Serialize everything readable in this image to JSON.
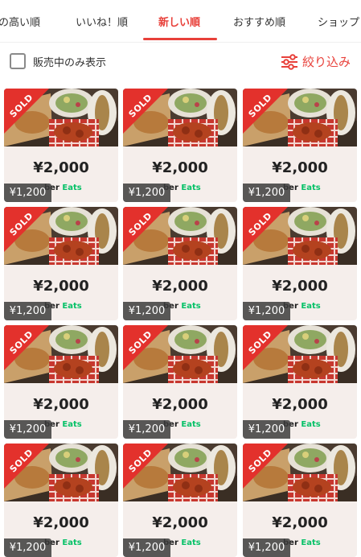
{
  "tabs": [
    {
      "label": "の高い順",
      "active": false
    },
    {
      "label": "いいね！順",
      "active": false
    },
    {
      "label": "新しい順",
      "active": true
    },
    {
      "label": "おすすめ順",
      "active": false
    },
    {
      "label": "ショップ",
      "active": false
    }
  ],
  "filter": {
    "checkbox_label": "販売中のみ表示",
    "checkbox_checked": false,
    "filter_button_label": "絞り込み",
    "filter_icon": "sliders-icon"
  },
  "colors": {
    "accent": "#e8403a",
    "sold": "#e3312c",
    "eats_green": "#06c167"
  },
  "items": [
    {
      "sold_label": "SOLD",
      "amount": "¥2,000",
      "brand_prefix": "ber",
      "brand_suffix": "Eats",
      "price": "¥1,200"
    },
    {
      "sold_label": "SOLD",
      "amount": "¥2,000",
      "brand_prefix": "ber",
      "brand_suffix": "Eats",
      "price": "¥1,200"
    },
    {
      "sold_label": "SOLD",
      "amount": "¥2,000",
      "brand_prefix": "ber",
      "brand_suffix": "Eats",
      "price": "¥1,200"
    },
    {
      "sold_label": "SOLD",
      "amount": "¥2,000",
      "brand_prefix": "ber",
      "brand_suffix": "Eats",
      "price": "¥1,200"
    },
    {
      "sold_label": "SOLD",
      "amount": "¥2,000",
      "brand_prefix": "ber",
      "brand_suffix": "Eats",
      "price": "¥1,200"
    },
    {
      "sold_label": "SOLD",
      "amount": "¥2,000",
      "brand_prefix": "ber",
      "brand_suffix": "Eats",
      "price": "¥1,200"
    },
    {
      "sold_label": "SOLD",
      "amount": "¥2,000",
      "brand_prefix": "ber",
      "brand_suffix": "Eats",
      "price": "¥1,200"
    },
    {
      "sold_label": "SOLD",
      "amount": "¥2,000",
      "brand_prefix": "ber",
      "brand_suffix": "Eats",
      "price": "¥1,200"
    },
    {
      "sold_label": "SOLD",
      "amount": "¥2,000",
      "brand_prefix": "ber",
      "brand_suffix": "Eats",
      "price": "¥1,200"
    },
    {
      "sold_label": "SOLD",
      "amount": "¥2,000",
      "brand_prefix": "ber",
      "brand_suffix": "Eats",
      "price": "¥1,200"
    },
    {
      "sold_label": "SOLD",
      "amount": "¥2,000",
      "brand_prefix": "ber",
      "brand_suffix": "Eats",
      "price": "¥1,200"
    },
    {
      "sold_label": "SOLD",
      "amount": "¥2,000",
      "brand_prefix": "ber",
      "brand_suffix": "Eats",
      "price": "¥1,200"
    }
  ]
}
